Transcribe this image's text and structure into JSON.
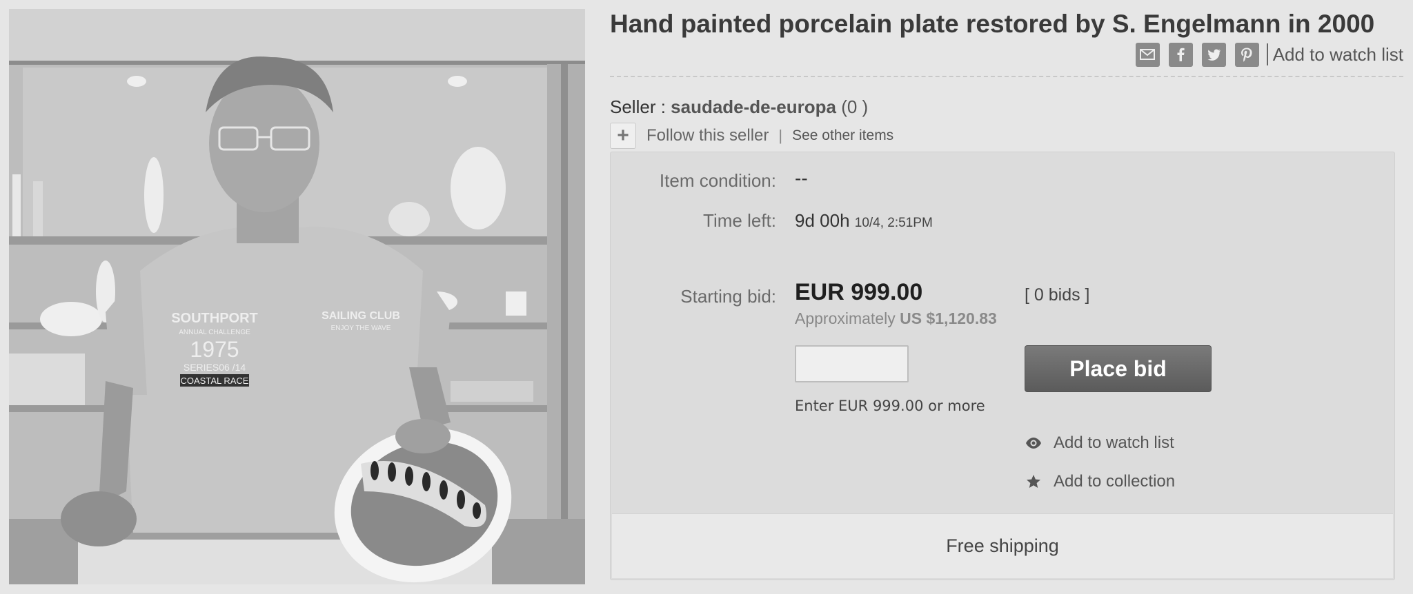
{
  "listing": {
    "title": "Hand painted porcelain plate restored by S. Engelmann in 2000",
    "image_alt": "Man holding a painted porcelain plate in front of a shelf of figurines"
  },
  "share": {
    "icons": [
      "mail-icon",
      "facebook-icon",
      "twitter-icon",
      "pinterest-icon"
    ],
    "separator": "|",
    "watch_label": "Add to watch list"
  },
  "seller": {
    "prefix": "Seller : ",
    "name": "saudade-de-europa",
    "score": "(0 )",
    "follow_label": "Follow this seller",
    "separator": "|",
    "other_items_label": "See other items"
  },
  "details": {
    "condition_label": "Item condition:",
    "condition_value": "--",
    "time_left_label": "Time left:",
    "time_left_value": "9d 00h",
    "time_left_end": "10/4, 2:51PM",
    "starting_bid_label": "Starting bid:",
    "starting_bid_value": "EUR 999.00",
    "bids_count": "[ 0 bids ]",
    "approx_prefix": "Approximately ",
    "approx_value": "US $1,120.83",
    "bid_input_value": "",
    "place_bid_label": "Place bid",
    "bid_hint": "Enter EUR 999.00 or more",
    "watch_label": "Add to watch list",
    "collection_label": "Add to collection",
    "shipping_label": "Free shipping"
  },
  "photo_shirt_text": {
    "left": [
      "SOUTHPORT",
      "ANNUAL CHALLENGE",
      "1975",
      "SERIES06 /14",
      "COASTAL RACE"
    ],
    "right": [
      "SAILING CLUB",
      "ENJOY THE WAVE"
    ]
  },
  "colors": {
    "background": "#e6e6e6",
    "button": "#666666",
    "panel": "#dcdcdc"
  }
}
